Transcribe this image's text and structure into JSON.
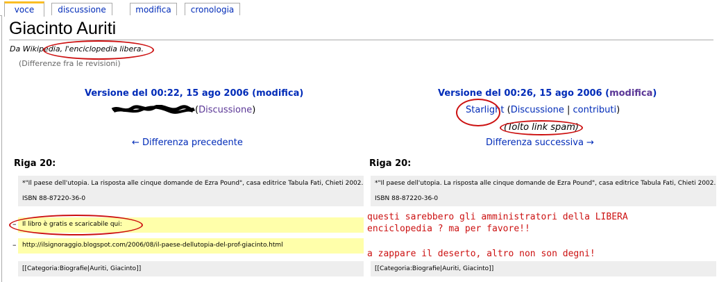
{
  "tabs": [
    {
      "label": "voce",
      "active": true
    },
    {
      "label": "discussione",
      "active": false
    },
    {
      "label": "modifica",
      "active": false
    },
    {
      "label": "cronologia",
      "active": false
    }
  ],
  "page": {
    "title": "Giacinto Auriti",
    "subtitle_prefix": "Da Wikipedia,",
    "subtitle_highlight": "l'enciclopedia libera.",
    "revisions_link": "(Differenze fra le revisioni)"
  },
  "left": {
    "version": "Versione del 00:22, 15 ago 2006",
    "edit": "modifica",
    "user_redacted": true,
    "discussion": "Discussione",
    "nav": "← Differenza precedente",
    "row_label": "Riga 20:",
    "context_text": "*\"Il paese dell'utopia. La risposta alle cinque domande de Ezra Pound\", casa editrice Tabula Fati, Chieti 2002. ISBN 88-87220-36-0",
    "removed": [
      "Il libro è gratis e scaricabile qui:",
      "http://ilsignoraggio.blogspot.com/2006/08/il-paese-dellutopia-del-prof-giacinto.html"
    ],
    "minus": "–",
    "footer_text": "[[Categoria:Biografie|Auriti, Giacinto]]"
  },
  "right": {
    "version": "Versione del 00:26, 15 ago 2006",
    "edit": "modifica",
    "user": "Starlight",
    "discussion": "Discussione",
    "sep": "|",
    "contrib": "contributi",
    "summary": "(Tolto link spam)",
    "nav": "Differenza successiva →",
    "row_label": "Riga 20:",
    "context_text": "*\"Il paese dell'utopia. La risposta alle cinque domande de Ezra Pound\", casa editrice Tabula Fati, Chieti 2002. ISBN 88-87220-36-0",
    "footer_text": "[[Categoria:Biografie|Auriti, Giacinto]]"
  },
  "annotation": {
    "line1": "questi sarebbero gli amministratori della LIBERA",
    "line2": "enciclopedia ? ma per favore!!",
    "line3": "a zappare il deserto, altro non son degni!"
  },
  "colors": {
    "link": "#002bb8",
    "visited": "#5a3696",
    "annotation": "#cc1111",
    "added_bg": "#ffffaa",
    "context_bg": "#eeeeee"
  }
}
